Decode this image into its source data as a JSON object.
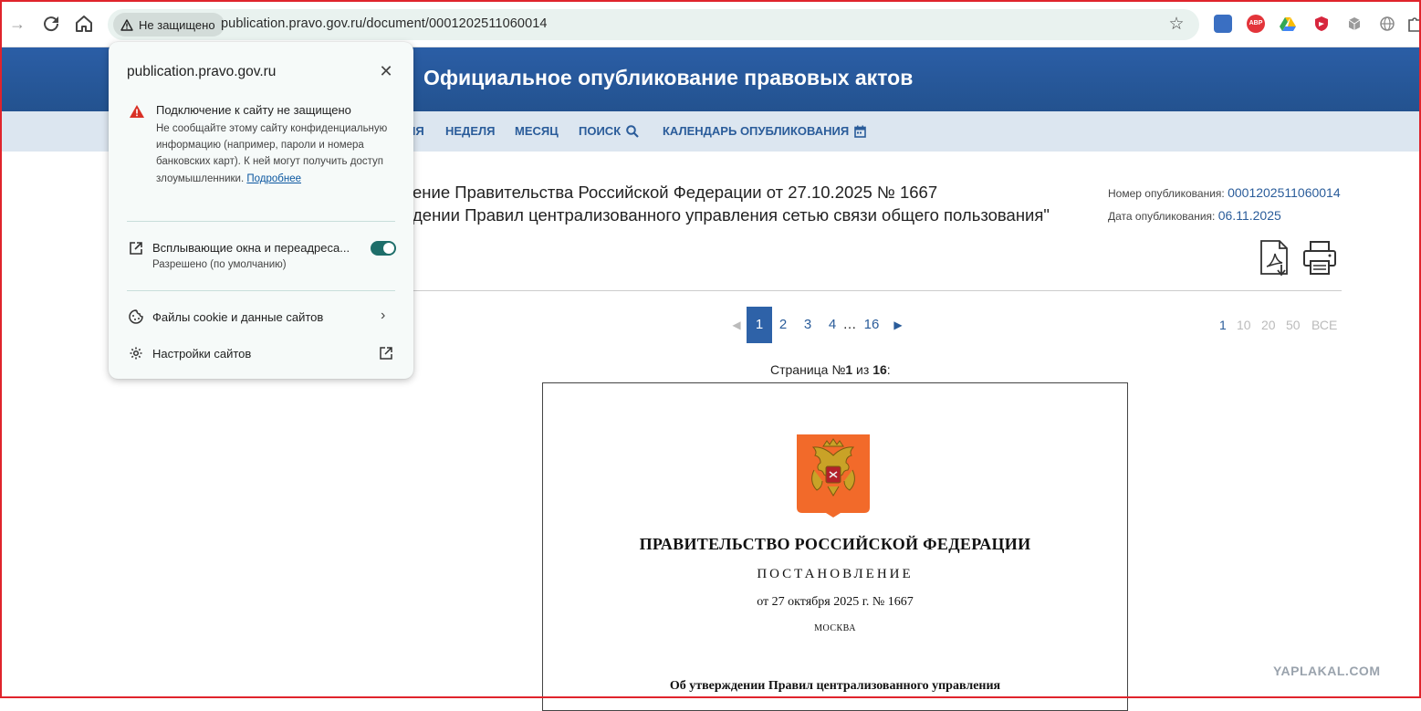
{
  "browser": {
    "security_chip": "Не защищено",
    "url": "publication.pravo.gov.ru/document/0001202511060014",
    "extensions": [
      {
        "name": "extension-1",
        "color": "#3a6fc2"
      },
      {
        "name": "adblock-plus",
        "label": "ABP",
        "color": "#e3343a"
      },
      {
        "name": "google-drive",
        "color": "#34a853"
      },
      {
        "name": "extension-shield",
        "color": "#d7263d"
      },
      {
        "name": "extension-box",
        "color": "#8b8b8b"
      },
      {
        "name": "extension-globe",
        "color": "#8b8b8b"
      },
      {
        "name": "extensions-puzzle",
        "color": "#555555"
      }
    ]
  },
  "site": {
    "title": "Официальное опубликование правовых актов",
    "nav": {
      "partial": "НЯ",
      "week": "НЕДЕЛЯ",
      "month": "МЕСЯЦ",
      "search": "ПОИСК",
      "calendar": "КАЛЕНДАРЬ ОПУБЛИКОВАНИЯ"
    }
  },
  "document": {
    "title_line1": "ение Правительства Российской Федерации от 27.10.2025 № 1667",
    "title_line2": "дении Правил централизованного управления сетью связи общего пользования\"",
    "pub_number_label": "Номер опубликования: ",
    "pub_number": "0001202511060014",
    "pub_date_label": "Дата опубликования: ",
    "pub_date": "06.11.2025"
  },
  "pagination": {
    "pages": [
      "1",
      "2",
      "3",
      "4"
    ],
    "ellipsis": "…",
    "last": "16",
    "per_page": [
      "1",
      "10",
      "20",
      "50",
      "ВСЕ"
    ],
    "page_info_prefix": "Страница №",
    "page_current": "1",
    "page_info_middle": " из ",
    "page_total": "16",
    "page_info_suffix": ":"
  },
  "page_content": {
    "government": "ПРАВИТЕЛЬСТВО  РОССИЙСКОЙ  ФЕДЕРАЦИИ",
    "decree": "ПОСТАНОВЛЕНИЕ",
    "date_line": "от 27 октября 2025 г. № 1667",
    "city": "МОСКВА",
    "subject": "Об утверждении Правил централизованного управления"
  },
  "popup": {
    "domain": "publication.pravo.gov.ru",
    "warning_title": "Подключение к сайту не защищено",
    "warning_text": "Не сообщайте этому сайту конфиденциальную информацию (например, пароли и номера банковских карт). К ней могут получить доступ злоумышленники. ",
    "learn_more": "Подробнее",
    "popups_label": "Всплывающие окна и переадреса...",
    "popups_status": "Разрешено (по умолчанию)",
    "cookies_label": "Файлы cookie и данные сайтов",
    "site_settings_label": "Настройки сайтов"
  },
  "watermark": "YAPLAKAL.COM",
  "colors": {
    "header_blue": "#2b5ea6",
    "nav_bg": "#dce6f0",
    "link_blue": "#2a5c9a",
    "toggle_on": "#1e6e6a",
    "warning_red": "#d93025"
  }
}
